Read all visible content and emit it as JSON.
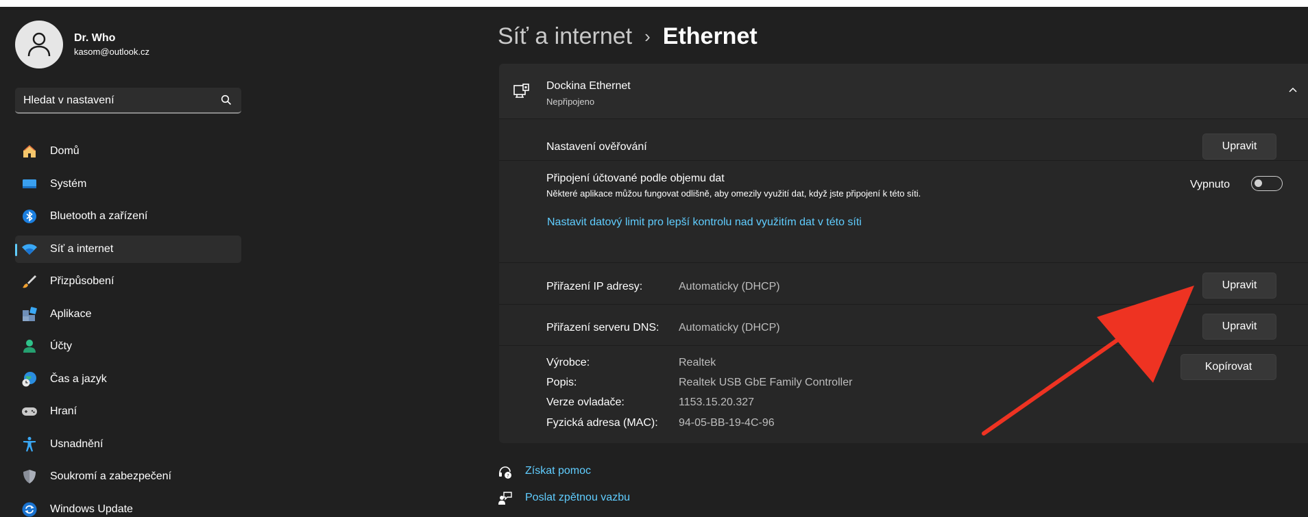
{
  "profile": {
    "name": "Dr. Who",
    "email": "kasom@outlook.cz"
  },
  "search": {
    "placeholder": "Hledat v nastavení"
  },
  "sidebar": {
    "items": [
      {
        "label": "Domů",
        "icon": "home-icon"
      },
      {
        "label": "Systém",
        "icon": "monitor-icon"
      },
      {
        "label": "Bluetooth a zařízení",
        "icon": "bluetooth-icon"
      },
      {
        "label": "Síť a internet",
        "icon": "wifi-icon",
        "active": true
      },
      {
        "label": "Přizpůsobení",
        "icon": "brush-icon"
      },
      {
        "label": "Aplikace",
        "icon": "apps-icon"
      },
      {
        "label": "Účty",
        "icon": "user-icon"
      },
      {
        "label": "Čas a jazyk",
        "icon": "globe-clock-icon"
      },
      {
        "label": "Hraní",
        "icon": "gamepad-icon"
      },
      {
        "label": "Usnadnění",
        "icon": "accessibility-icon"
      },
      {
        "label": "Soukromí a zabezpečení",
        "icon": "shield-icon"
      },
      {
        "label": "Windows Update",
        "icon": "update-icon"
      }
    ]
  },
  "breadcrumb": {
    "parent": "Síť a internet",
    "separator": "›",
    "current": "Ethernet"
  },
  "adapter": {
    "name": "Dockina Ethernet",
    "status": "Nepřipojeno"
  },
  "auth": {
    "label": "Nastavení ověřování",
    "button": "Upravit"
  },
  "metered": {
    "title": "Připojení účtované podle objemu dat",
    "description": "Některé aplikace můžou fungovat odlišně, aby omezily využití dat, když jste připojení k této síti.",
    "state": "Vypnuto",
    "enabled": false,
    "link": "Nastavit datový limit pro lepší kontrolu nad využitím dat v této síti"
  },
  "ip": {
    "label": "Přiřazení IP adresy:",
    "value": "Automaticky (DHCP)",
    "button": "Upravit"
  },
  "dns": {
    "label": "Přiřazení serveru DNS:",
    "value": "Automaticky (DHCP)",
    "button": "Upravit"
  },
  "properties": {
    "copy_button": "Kopírovat",
    "rows": [
      {
        "label": "Výrobce:",
        "value": "Realtek"
      },
      {
        "label": "Popis:",
        "value": "Realtek USB GbE Family Controller"
      },
      {
        "label": "Verze ovladače:",
        "value": "1153.15.20.327"
      },
      {
        "label": "Fyzická adresa (MAC):",
        "value": "94-05-BB-19-4C-96"
      }
    ]
  },
  "footer": {
    "help": "Získat pomoc",
    "feedback": "Poslat zpětnou vazbu"
  },
  "colors": {
    "background": "#202020",
    "card": "#272727",
    "accent": "#60cdff",
    "annotation_arrow": "#ee3322"
  }
}
